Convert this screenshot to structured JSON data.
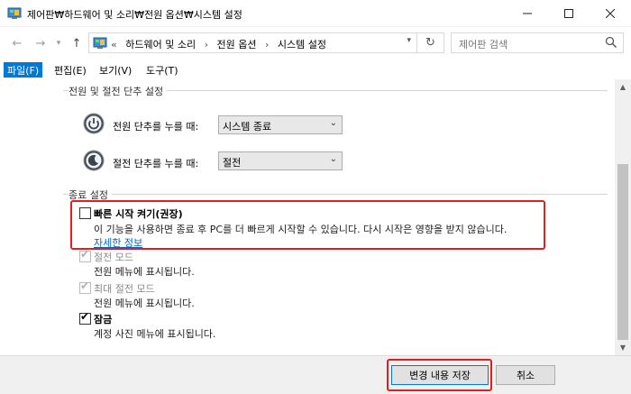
{
  "window": {
    "title": "제어판₩하드웨어 및 소리₩전원 옵션₩시스템 설정",
    "app_icon": "control-panel-icon"
  },
  "address_bar": {
    "prefix": "«",
    "crumbs": [
      "하드웨어 및 소리",
      "전원 옵션",
      "시스템 설정"
    ],
    "separator": "›"
  },
  "search": {
    "placeholder": "제어판 검색"
  },
  "menu": {
    "items": [
      "파일(F)",
      "편집(E)",
      "보기(V)",
      "도구(T)"
    ],
    "active_index": 0
  },
  "power_buttons": {
    "group_title": "전원 및 절전 단추 설정",
    "rows": [
      {
        "label": "전원 단추를 누를 때:",
        "value": "시스템 종료"
      },
      {
        "label": "절전 단추를 누를 때:",
        "value": "절전"
      }
    ]
  },
  "shutdown": {
    "group_title": "종료 설정",
    "fast_startup": {
      "title": "빠른 시작 켜기(권장)",
      "checked": false,
      "description": "이 기능을 사용하면 종료 후 PC를 더 빠르게 시작할 수 있습니다. 다시 시작은 영향을 받지 않습니다.",
      "link": "자세한 정보"
    },
    "sleep": {
      "title": "절전 모드",
      "description": "전원 메뉴에 표시됩니다.",
      "checked": true,
      "enabled": false
    },
    "hibernate": {
      "title": "최대 절전 모드",
      "description": "전원 메뉴에 표시됩니다.",
      "checked": true,
      "enabled": false
    },
    "lock": {
      "title": "잠금",
      "description": "계정 사진 메뉴에 표시됩니다.",
      "checked": true,
      "enabled": true
    }
  },
  "footer": {
    "save_label": "변경 내용 저장",
    "cancel_label": "취소"
  },
  "colors": {
    "accent": "#0078d7",
    "highlight": "#e02020",
    "link": "#0066cc"
  }
}
